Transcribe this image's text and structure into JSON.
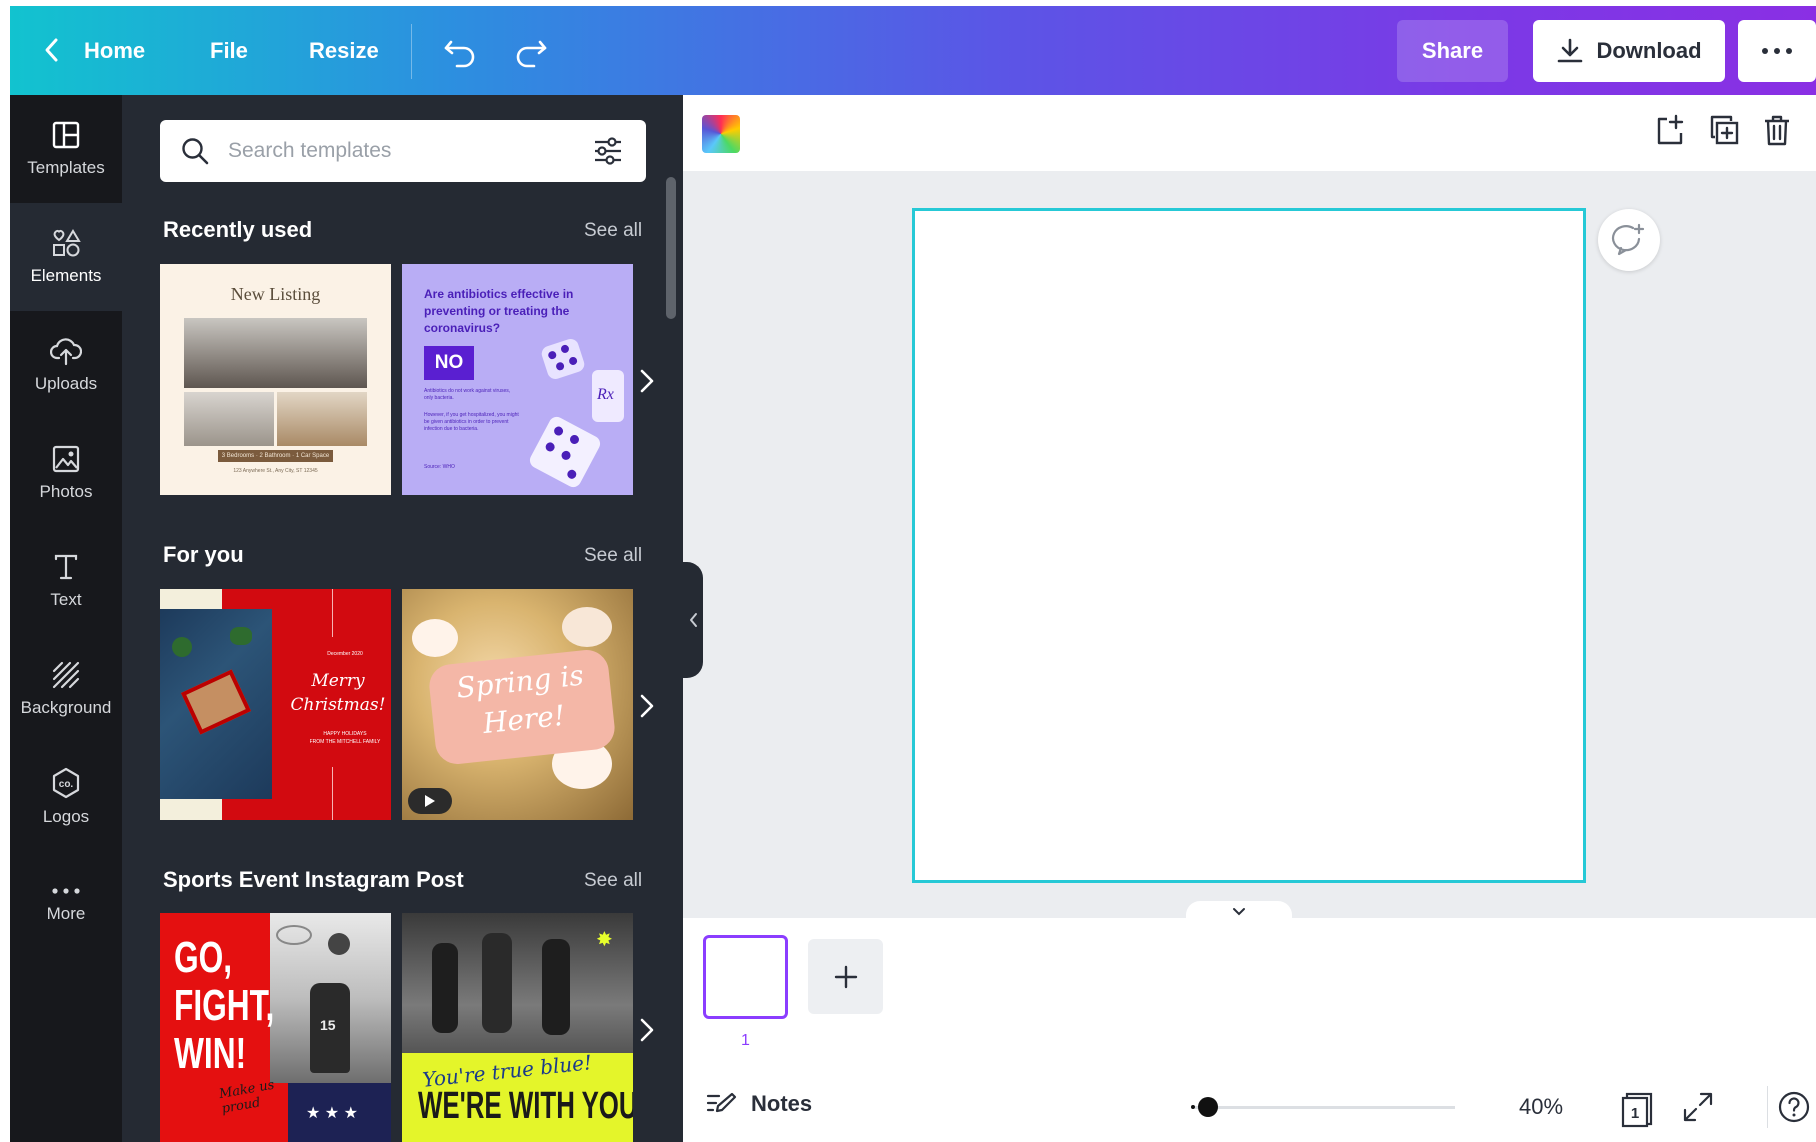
{
  "topbar": {
    "home": "Home",
    "file": "File",
    "resize": "Resize",
    "share": "Share",
    "download": "Download"
  },
  "rail": {
    "items": [
      {
        "label": "Templates",
        "icon": "templates-icon"
      },
      {
        "label": "Elements",
        "icon": "elements-icon"
      },
      {
        "label": "Uploads",
        "icon": "upload-cloud-icon"
      },
      {
        "label": "Photos",
        "icon": "photo-icon"
      },
      {
        "label": "Text",
        "icon": "text-icon"
      },
      {
        "label": "Background",
        "icon": "background-icon"
      },
      {
        "label": "Logos",
        "icon": "logo-icon"
      },
      {
        "label": "More",
        "icon": "more-dots-icon"
      }
    ]
  },
  "panel": {
    "search_placeholder": "Search templates",
    "sections": [
      {
        "title": "Recently used",
        "see_all": "See all",
        "templates": [
          {
            "kind": "listing",
            "title": "New Listing",
            "subtitle": "3 Bedrooms · 2 Bathroom · 1 Car Space",
            "address": "123 Anywhere St., Any City, ST 12345"
          },
          {
            "kind": "antibiotics",
            "question": "Are antibiotics effective in preventing or treating the coronavirus?",
            "answer": "NO",
            "body1": "Antibiotics do not work against viruses, only bacteria.",
            "body2": "However, if you get hospitalized, you might be given antibiotics in order to prevent infection due to bacteria.",
            "source": "Source: WHO",
            "rx": "Rx"
          }
        ]
      },
      {
        "title": "For you",
        "see_all": "See all",
        "templates": [
          {
            "kind": "christmas",
            "date": "December 2020",
            "title": "Merry Christmas!",
            "sub1": "HAPPY HOLIDAYS",
            "sub2": "FROM THE MITCHELL FAMILY"
          },
          {
            "kind": "spring",
            "title": "Spring is Here!"
          }
        ]
      },
      {
        "title": "Sports Event Instagram Post",
        "see_all": "See all",
        "templates": [
          {
            "kind": "gofight",
            "lines": [
              "GO,",
              "FIGHT,",
              "WIN!"
            ],
            "script": "Make us proud",
            "jersey": "15",
            "stars": "★ ★ ★"
          },
          {
            "kind": "blue",
            "script": "You're true blue!",
            "headline": "WE'RE WITH YOU!"
          }
        ]
      }
    ]
  },
  "footer": {
    "page_number": "1",
    "notes": "Notes",
    "zoom": "40%",
    "zoom_fraction": 0.05,
    "page_count_badge": "1"
  },
  "colors": {
    "accent_purple": "#8b3dff",
    "page_border": "#26c9d6",
    "panel_bg": "#252a33",
    "rail_bg": "#17181c"
  }
}
